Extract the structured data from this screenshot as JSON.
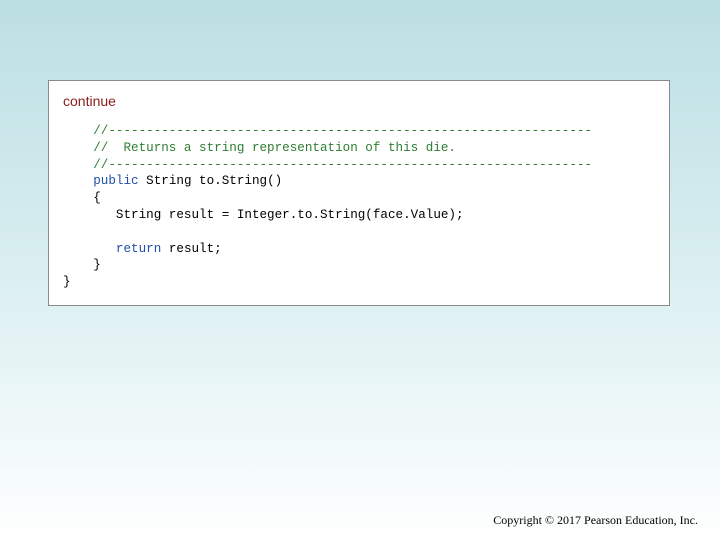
{
  "slide": {
    "continue_label": "continue",
    "code": {
      "indent1": "    ",
      "indent2": "       ",
      "rule_line": "//----------------------------------------------------------------",
      "comment_line": "//  Returns a string representation of this die.",
      "kw_public": "public",
      "sig_rest": " String to.String()",
      "open_brace": "{",
      "stmt_line": "String result = Integer.to.String(face.Value);",
      "kw_return": "return",
      "return_rest": " result;",
      "close_brace_inner": "}",
      "close_brace_outer": "}"
    },
    "footer": "Copyright © 2017 Pearson Education, Inc."
  },
  "colors": {
    "continue": "#8b1a1a",
    "comment": "#2e7d32",
    "keyword": "#1f4eaa"
  }
}
